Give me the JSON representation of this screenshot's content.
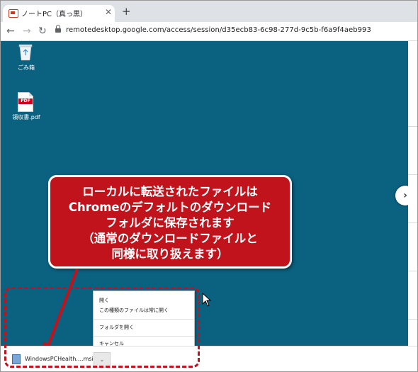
{
  "tab": {
    "title": "ノートPC（真っ黒）",
    "close": "✕"
  },
  "newtab": "+",
  "toolbar": {
    "back": "←",
    "forward": "→",
    "reload": "↻",
    "url": "remotedesktop.google.com/access/session/d35ecb83-6c98-277d-9c5b-f6a9f4aeb993"
  },
  "desktop": {
    "icons": [
      {
        "label": "ごみ箱",
        "icon": "recycle-bin-icon"
      },
      {
        "label": "領収書.pdf",
        "icon": "pdf-file-icon",
        "badge": "PDF"
      }
    ],
    "next_glyph": "›",
    "background": "#0b6180"
  },
  "callout": {
    "lines": [
      "ローカルに転送されたファイルは",
      "Chromeのデフォルトのダウンロード",
      "フォルダに保存されます",
      "（通常のダウンロードファイルと",
      "同様に取り扱えます）"
    ],
    "color": "#c0131b"
  },
  "context_menu": {
    "items": [
      "開く",
      "この種類のファイルは常に開く",
      "フォルダを開く",
      "キャンセル"
    ]
  },
  "download": {
    "file_name": "WindowsPCHealth....msi",
    "arrow": "⌄"
  }
}
